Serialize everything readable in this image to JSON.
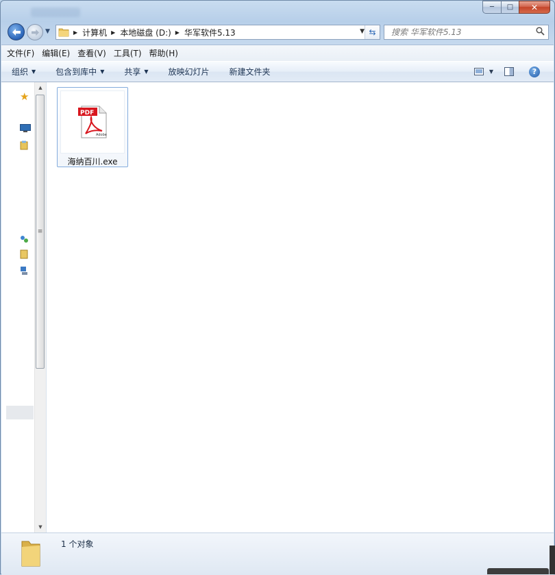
{
  "window": {
    "caption": {
      "minimize": "─",
      "maximize": "□",
      "close": "✕"
    }
  },
  "address": {
    "crumbs": [
      "计算机",
      "本地磁盘 (D:)",
      "华军软件5.13"
    ]
  },
  "search": {
    "placeholder": "搜索 华军软件5.13"
  },
  "menubar": {
    "items": [
      "文件(F)",
      "编辑(E)",
      "查看(V)",
      "工具(T)",
      "帮助(H)"
    ]
  },
  "toolbar": {
    "organize": "组织",
    "include_library": "包含到库中",
    "share": "共享",
    "slideshow": "放映幻灯片",
    "new_folder": "新建文件夹"
  },
  "files": [
    {
      "name": "海纳百川.exe",
      "icon": "pdf-icon"
    }
  ],
  "status": {
    "text": "1 个对象"
  },
  "colors": {
    "accent": "#2a64b8",
    "close": "#c4452a",
    "pdf_red": "#d8161e"
  }
}
